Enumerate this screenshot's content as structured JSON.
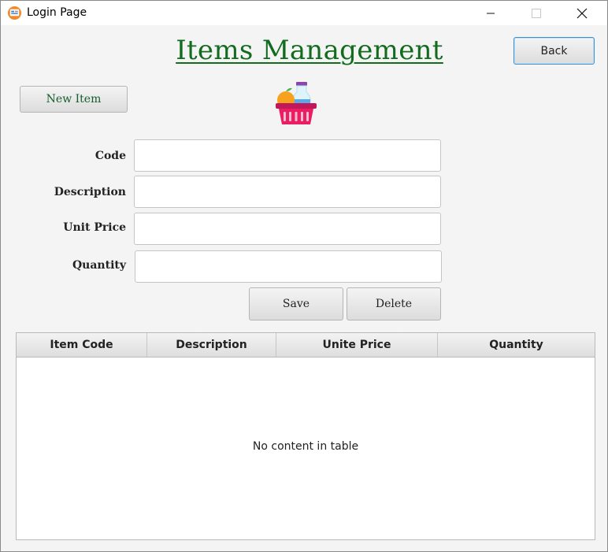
{
  "window": {
    "title": "Login Page",
    "app_icon": "app-window-icon",
    "controls": {
      "minimize_icon": "minimize-icon",
      "maximize_icon": "maximize-icon",
      "close_icon": "close-icon"
    }
  },
  "header": {
    "title": "Items Management",
    "back_label": "Back",
    "title_color": "#126b1e"
  },
  "toolbar": {
    "new_item_label": "New Item",
    "basket_icon": "shopping-basket-icon"
  },
  "form": {
    "code_label": "Code",
    "code_value": "",
    "description_label": "Description",
    "description_value": "",
    "unit_price_label": "Unit Price",
    "unit_price_value": "",
    "quantity_label": "Quantity",
    "quantity_value": "",
    "save_label": "Save",
    "delete_label": "Delete"
  },
  "table": {
    "columns": [
      "Item Code",
      "Description",
      "Unite Price",
      "Quantity"
    ],
    "rows": [],
    "empty_message": "No content in table"
  }
}
